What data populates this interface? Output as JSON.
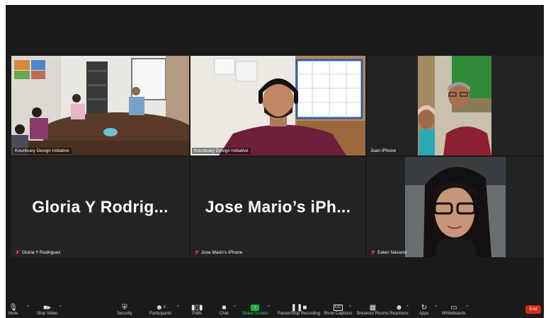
{
  "tiles": [
    {
      "id": "kd-room",
      "name": "Kounkuey Design Initiative",
      "muted": false,
      "active": true
    },
    {
      "id": "kd-cam",
      "name": "Kounkuey Design Initiative",
      "muted": false,
      "active": false
    },
    {
      "id": "juan",
      "name": "Juan iPhone",
      "muted": false,
      "active": false
    },
    {
      "id": "gloria",
      "name": "Gloria Y Rodriguez",
      "display_name": "Gloria Y Rodrig...",
      "muted": true
    },
    {
      "id": "jose",
      "name": "Jose Mario’s iPhone",
      "display_name": "Jose Mario’s iPh...",
      "muted": true
    },
    {
      "id": "eelen",
      "name": "Eelen Navarro",
      "muted": true
    }
  ],
  "toolbar": {
    "mute": "Mute",
    "stop_video": "Stop Video",
    "security": "Security",
    "participants": "Participants",
    "participants_count": "6",
    "polls": "Polls",
    "chat": "Chat",
    "share_screen": "Share Screen",
    "pause_recording": "Pause/Stop Recording",
    "captions": "Show Captions",
    "breakout": "Breakout Rooms",
    "reactions": "Reactions",
    "apps": "Apps",
    "whiteboards": "Whiteboards",
    "end": "End"
  },
  "icons": {
    "mute": "microphone-icon",
    "stop_video": "video-camera-icon",
    "security": "shield-icon",
    "participants": "participants-icon",
    "polls": "bar-chart-icon",
    "chat": "chat-bubble-icon",
    "share_screen": "share-screen-icon",
    "pause_recording": "pause-stop-icon",
    "captions": "cc-icon",
    "breakout": "grid-icon",
    "reactions": "reaction-icon",
    "apps": "apps-icon",
    "whiteboards": "whiteboard-icon"
  },
  "colors": {
    "active_border": "#c8df3a",
    "share_green": "#1fb040",
    "end_red": "#d9291c",
    "muted_red": "#e02828"
  }
}
